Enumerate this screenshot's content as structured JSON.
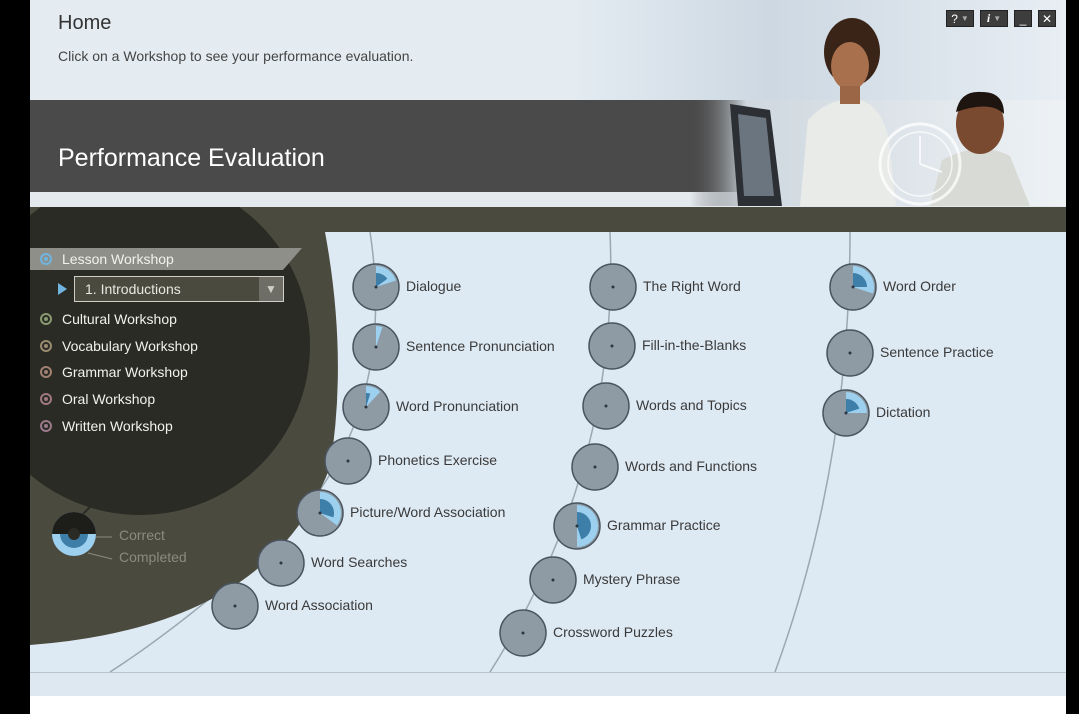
{
  "header": {
    "title": "Home",
    "subtitle": "Click on a Workshop to see your performance evaluation."
  },
  "window_buttons": {
    "help": "?",
    "info": "i",
    "minimize": "_",
    "close": "✕"
  },
  "banner": {
    "title": "Performance Evaluation"
  },
  "sidebar": {
    "items": [
      {
        "label": "Lesson Workshop",
        "selected": true
      },
      {
        "label": "Cultural Workshop"
      },
      {
        "label": "Vocabulary Workshop"
      },
      {
        "label": "Grammar Workshop"
      },
      {
        "label": "Oral Workshop"
      },
      {
        "label": "Written Workshop"
      }
    ],
    "lesson_select": {
      "value": "1. Introductions"
    }
  },
  "legend": {
    "correct": "Correct",
    "completed": "Completed"
  },
  "exercises": {
    "column1": [
      {
        "label": "Dialogue",
        "completed": 0.2,
        "correct": 0.15
      },
      {
        "label": "Sentence Pronunciation",
        "completed": 0.05,
        "correct": 0
      },
      {
        "label": "Word Pronunciation",
        "completed": 0.12,
        "correct": 0.05
      },
      {
        "label": "Phonetics Exercise",
        "completed": 0,
        "correct": 0
      },
      {
        "label": "Picture/Word Association",
        "completed": 0.35,
        "correct": 0.3
      },
      {
        "label": "Word Searches",
        "completed": 0,
        "correct": 0
      },
      {
        "label": "Word Association",
        "completed": 0,
        "correct": 0
      }
    ],
    "column2": [
      {
        "label": "The Right Word",
        "completed": 0,
        "correct": 0
      },
      {
        "label": "Fill-in-the-Blanks",
        "completed": 0,
        "correct": 0
      },
      {
        "label": "Words and Topics",
        "completed": 0,
        "correct": 0
      },
      {
        "label": "Words and Functions",
        "completed": 0,
        "correct": 0
      },
      {
        "label": "Grammar Practice",
        "completed": 0.5,
        "correct": 0.45
      },
      {
        "label": "Mystery Phrase",
        "completed": 0,
        "correct": 0
      },
      {
        "label": "Crossword Puzzles",
        "completed": 0,
        "correct": 0
      }
    ],
    "column3": [
      {
        "label": "Word Order",
        "completed": 0.3,
        "correct": 0.25
      },
      {
        "label": "Sentence Practice",
        "completed": 0,
        "correct": 0
      },
      {
        "label": "Dictation",
        "completed": 0.25,
        "correct": 0.2
      }
    ]
  },
  "colors": {
    "completed": "#9cd0ee",
    "correct": "#3d7fa8",
    "node": "#8e9ba5",
    "panel": "#4b4a3e",
    "accent_arrow": "#6fb5e0"
  }
}
